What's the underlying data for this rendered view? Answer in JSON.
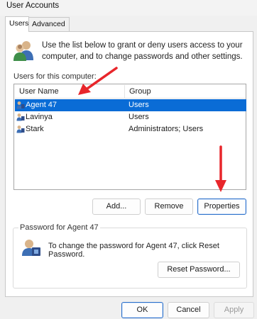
{
  "window": {
    "title": "User Accounts"
  },
  "tabs": [
    {
      "label": "Users",
      "active": true
    },
    {
      "label": "Advanced",
      "active": false
    }
  ],
  "intro": {
    "icon": "users-group-icon",
    "text": "Use the list below to grant or deny users access to your computer, and to change passwords and other settings."
  },
  "users": {
    "label": "Users for this computer:",
    "columns": [
      "User Name",
      "Group"
    ],
    "rows": [
      {
        "name": "Agent 47",
        "group": "Users",
        "selected": true
      },
      {
        "name": "Lavinya",
        "group": "Users",
        "selected": false
      },
      {
        "name": "Stark",
        "group": "Administrators; Users",
        "selected": false
      }
    ]
  },
  "actions": {
    "add": "Add...",
    "remove": "Remove",
    "properties": "Properties"
  },
  "password": {
    "group_title": "Password for Agent 47",
    "text": "To change the password for Agent 47, click Reset Password.",
    "reset": "Reset Password...",
    "icon": "user-key-icon"
  },
  "footer": {
    "ok": "OK",
    "cancel": "Cancel",
    "apply": "Apply"
  },
  "colors": {
    "selection": "#0a6cd6",
    "arrow": "#e8262b",
    "default_button_border": "#2a6fc9"
  }
}
